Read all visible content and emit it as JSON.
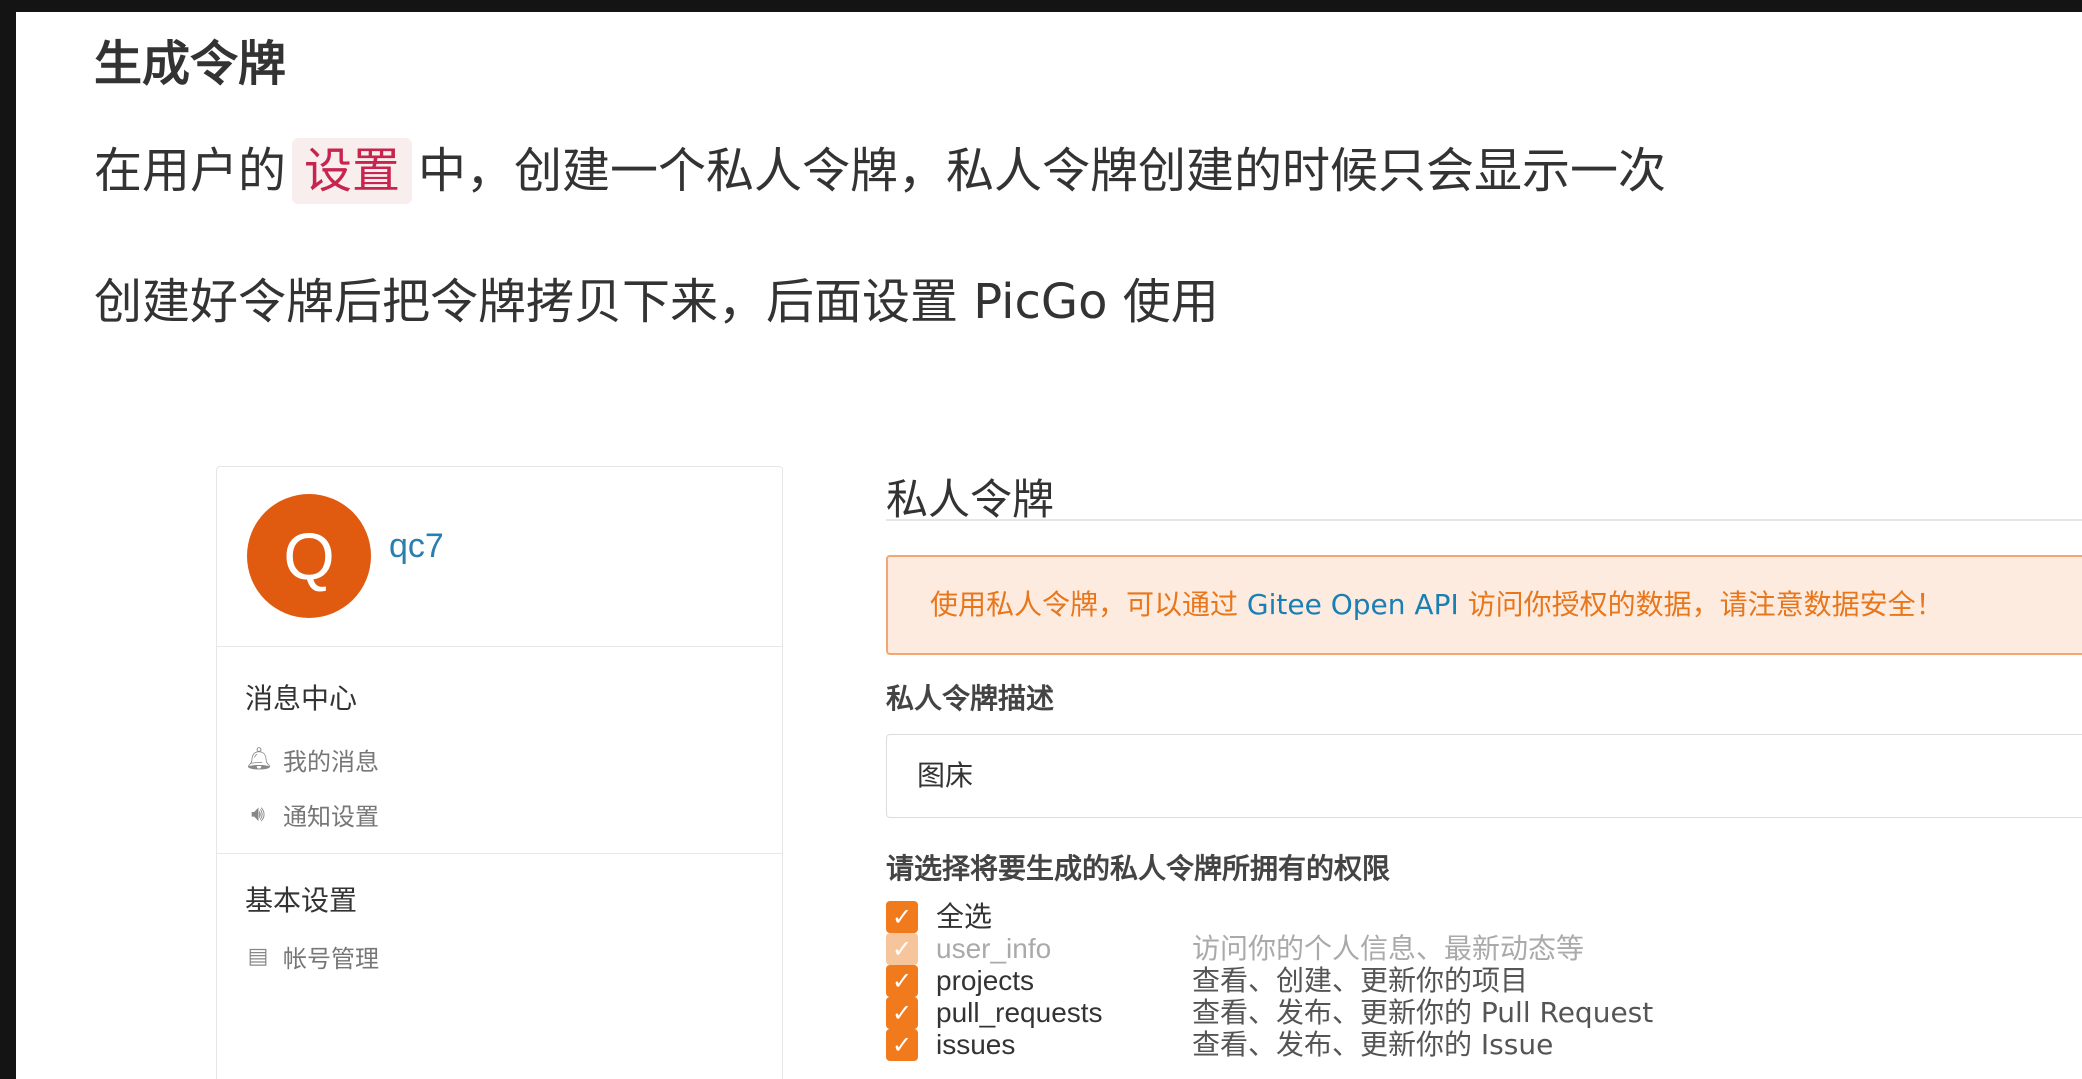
{
  "doc": {
    "heading": "生成令牌",
    "para1_before": "在用户的",
    "para1_code": "设置",
    "para1_after": "中，创建一个私人令牌，私人令牌创建的时候只会显示一次",
    "para2": "创建好令牌后把令牌拷贝下来，后面设置 PicGo 使用"
  },
  "sidebar": {
    "avatar_letter": "Q",
    "username": "qc7",
    "sections": [
      {
        "title": "消息中心",
        "items": [
          {
            "label": "我的消息",
            "icon": "bell-icon"
          },
          {
            "label": "通知设置",
            "icon": "speaker-icon"
          }
        ]
      },
      {
        "title": "基本设置",
        "items": [
          {
            "label": "帐号管理",
            "icon": "id-card-icon"
          }
        ]
      }
    ]
  },
  "panel": {
    "title": "私人令牌",
    "alert_before": "使用私人令牌，可以通过",
    "alert_link": "Gitee Open API",
    "alert_after": "访问你授权的数据，请注意数据安全！",
    "desc_label": "私人令牌描述",
    "desc_value": "图床",
    "perm_label": "请选择将要生成的私人令牌所拥有的权限",
    "select_all": "全选",
    "permissions": [
      {
        "name": "user_info",
        "desc": "访问你的个人信息、最新动态等",
        "checked": true,
        "disabled": true
      },
      {
        "name": "projects",
        "desc": "查看、创建、更新你的项目",
        "checked": true,
        "disabled": false
      },
      {
        "name": "pull_requests",
        "desc": "查看、发布、更新你的 Pull Request",
        "checked": true,
        "disabled": false
      },
      {
        "name": "issues",
        "desc": "查看、发布、更新你的 Issue",
        "checked": true,
        "disabled": false
      }
    ]
  },
  "colors": {
    "accent_orange": "#f07a1c",
    "link_blue": "#1a7fb5",
    "avatar_bg": "#e05a10",
    "inline_code_text": "#c7254e"
  }
}
